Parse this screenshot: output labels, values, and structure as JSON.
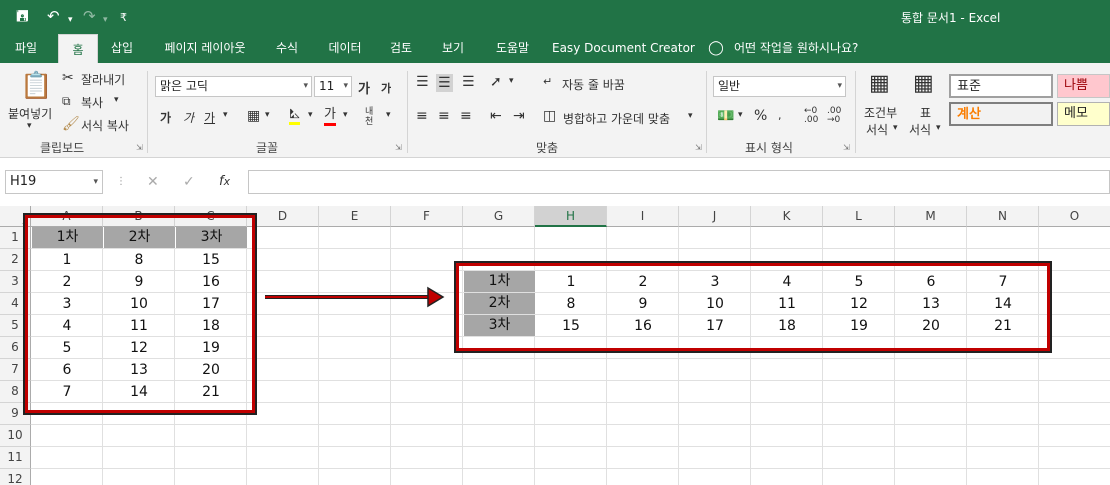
{
  "titlebar": {
    "title": "통합 문서1  -  Excel",
    "customize_glyph": "₹"
  },
  "tabs": [
    "파일",
    "홈",
    "삽입",
    "페이지 레이아웃",
    "수식",
    "데이터",
    "검토",
    "보기",
    "도움말",
    "Easy Document Creator"
  ],
  "tell_me": "어떤 작업을 원하시나요?",
  "clipboard": {
    "paste": "붙여넣기",
    "cut": "잘라내기",
    "copy": "복사",
    "format_painter": "서식 복사",
    "group": "클립보드"
  },
  "font": {
    "name": "맑은 고딕",
    "size": "11",
    "group": "글꼴",
    "grow": "가",
    "shrink": "가",
    "bold": "가",
    "italic": "가",
    "underline": "가",
    "color_letter": "가",
    "phonetic": "내천"
  },
  "alignment": {
    "wrap": "자동 줄 바꿈",
    "merge": "병합하고 가운데 맞춤",
    "group": "맞춤"
  },
  "number": {
    "format": "일반",
    "percent": "%",
    "group": "표시 형식"
  },
  "styles": {
    "conditional": "조건부 서식",
    "conditional_l1": "조건부",
    "conditional_l2": "서식",
    "table_l1": "표",
    "table_l2": "서식",
    "normal": "표준",
    "bad": "나쁨",
    "calc": "계산",
    "memo": "메모"
  },
  "formula_bar": {
    "name_box": "H19",
    "value": ""
  },
  "columns": [
    "A",
    "B",
    "C",
    "D",
    "E",
    "F",
    "G",
    "H",
    "I",
    "J",
    "K",
    "L",
    "M",
    "N",
    "O"
  ],
  "selected_column": "H",
  "rows": [
    "1",
    "2",
    "3",
    "4",
    "5",
    "6",
    "7",
    "8",
    "9",
    "10",
    "11",
    "12"
  ],
  "vertical_table": {
    "headers": [
      "1차",
      "2차",
      "3차"
    ],
    "rows": [
      [
        "1",
        "8",
        "15"
      ],
      [
        "2",
        "9",
        "16"
      ],
      [
        "3",
        "10",
        "17"
      ],
      [
        "4",
        "11",
        "18"
      ],
      [
        "5",
        "12",
        "19"
      ],
      [
        "6",
        "13",
        "20"
      ],
      [
        "7",
        "14",
        "21"
      ]
    ]
  },
  "transposed_table": {
    "headers": [
      "1차",
      "2차",
      "3차"
    ],
    "rows": [
      [
        "1",
        "2",
        "3",
        "4",
        "5",
        "6",
        "7"
      ],
      [
        "8",
        "9",
        "10",
        "11",
        "12",
        "13",
        "14"
      ],
      [
        "15",
        "16",
        "17",
        "18",
        "19",
        "20",
        "21"
      ]
    ]
  },
  "colors": {
    "excel_green": "#217346",
    "header_fill": "#a6a6a6",
    "frame_red": "#c00000",
    "bad_fill": "#ffc7ce",
    "bad_text": "#9c0006",
    "calc_fill": "#f2f2f2",
    "calc_text": "#fa7d00",
    "memo_fill": "#ffffcc"
  }
}
